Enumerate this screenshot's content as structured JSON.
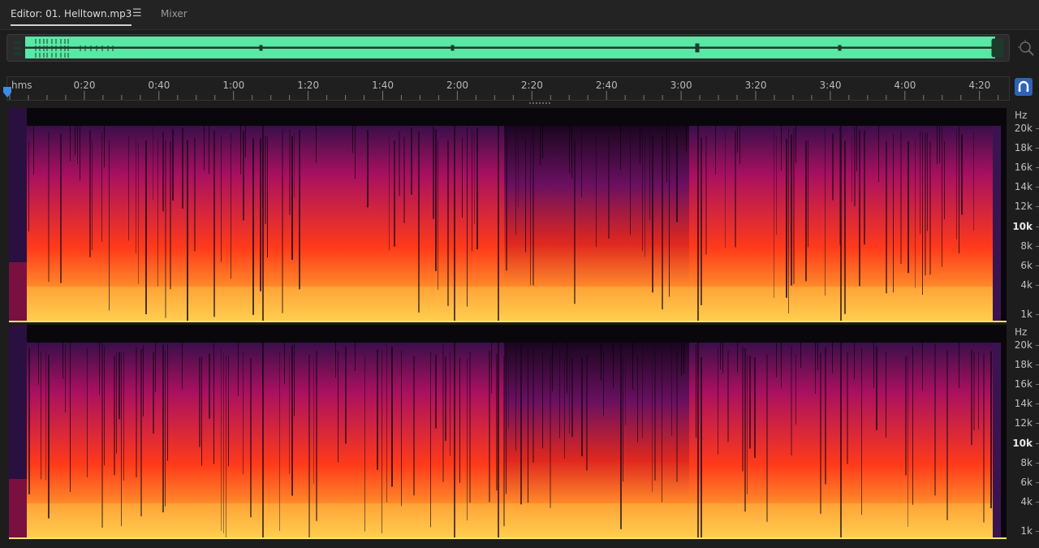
{
  "tabs": {
    "editor_label": "Editor: 01. Helltown.mp3",
    "menu_glyph": "☰",
    "mixer_label": "Mixer"
  },
  "overview": {
    "waveform_color": "#59e8a6",
    "zoom_icon": "zoom-navigator-icon"
  },
  "ruler": {
    "labels": [
      "hms",
      "0:20",
      "0:40",
      "1:00",
      "1:20",
      "1:40",
      "2:00",
      "2:20",
      "2:40",
      "3:00",
      "3:20",
      "3:40",
      "4:00",
      "4:20"
    ],
    "snap_icon": "magnet-icon",
    "accent": "#2e63b5"
  },
  "channels": [
    {
      "hz_unit": "Hz",
      "hz_labels": [
        "20k",
        "18k",
        "16k",
        "14k",
        "12k",
        "10k",
        "8k",
        "6k",
        "4k",
        "1k"
      ],
      "hz_bold": "10k"
    },
    {
      "hz_unit": "Hz",
      "hz_labels": [
        "20k",
        "18k",
        "16k",
        "14k",
        "12k",
        "10k",
        "8k",
        "6k",
        "4k",
        "1k"
      ],
      "hz_bold": "10k"
    }
  ],
  "spectrogram_colors": {
    "background": "#0a070c",
    "low": "#3a0f4a",
    "mid": "#a81060",
    "high": "#ff3a1a",
    "peak": "#ffd050"
  }
}
